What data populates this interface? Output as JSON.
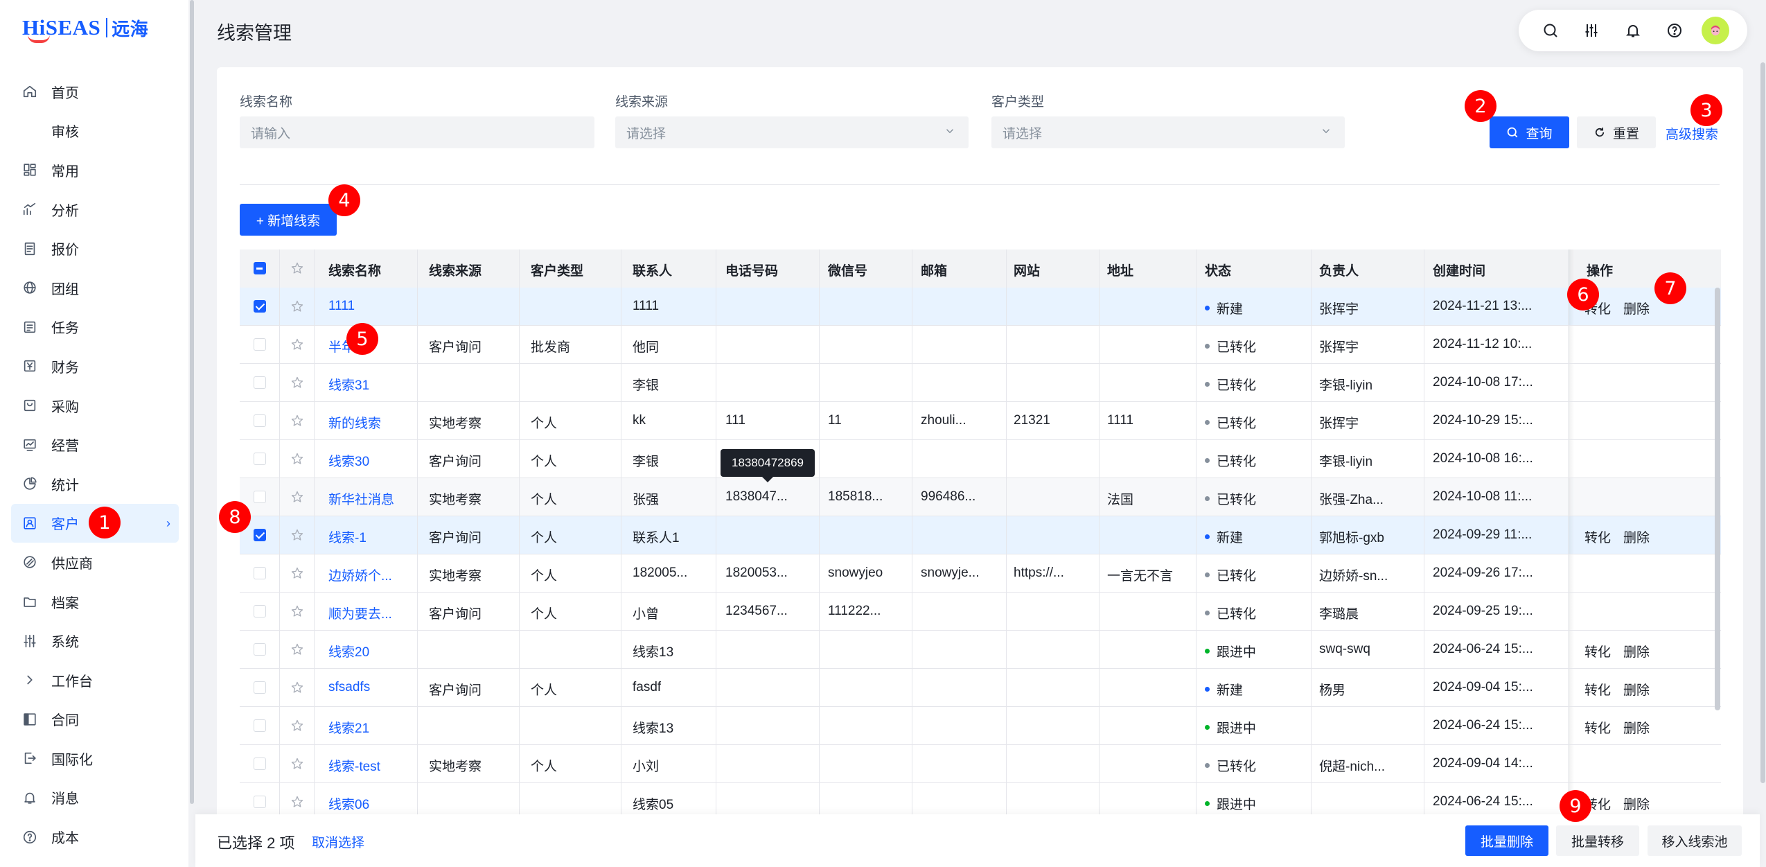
{
  "logo": {
    "brand": "HiSEAS",
    "brand_cn": "远海"
  },
  "page_title": "线索管理",
  "sidebar": {
    "items": [
      {
        "label": "首页",
        "icon": "home-icon"
      },
      {
        "label": "审核",
        "icon": ""
      },
      {
        "label": "常用",
        "icon": "grid-icon"
      },
      {
        "label": "分析",
        "icon": "trend-icon"
      },
      {
        "label": "报价",
        "icon": "doc-icon"
      },
      {
        "label": "团组",
        "icon": "globe-icon"
      },
      {
        "label": "任务",
        "icon": "task-icon"
      },
      {
        "label": "财务",
        "icon": "yen-icon"
      },
      {
        "label": "采购",
        "icon": "bag-icon"
      },
      {
        "label": "经营",
        "icon": "chart-icon"
      },
      {
        "label": "统计",
        "icon": "pie-icon"
      },
      {
        "label": "客户",
        "icon": "customer-icon",
        "active": true
      },
      {
        "label": "供应商",
        "icon": "link-icon"
      },
      {
        "label": "档案",
        "icon": "folder-icon"
      },
      {
        "label": "系统",
        "icon": "sliders-icon"
      },
      {
        "label": "工作台",
        "icon": "chevron-right-icon"
      },
      {
        "label": "合同",
        "icon": "contract-icon"
      },
      {
        "label": "国际化",
        "icon": "logout-icon"
      },
      {
        "label": "消息",
        "icon": "bell-icon"
      },
      {
        "label": "成本",
        "icon": "help-icon"
      }
    ]
  },
  "filters": {
    "name_label": "线索名称",
    "name_placeholder": "请输入",
    "source_label": "线索来源",
    "source_placeholder": "请选择",
    "customer_type_label": "客户类型",
    "customer_type_placeholder": "请选择",
    "query_button": "查询",
    "reset_button": "重置",
    "advanced_search": "高级搜索"
  },
  "add_button": "+ 新增线索",
  "table": {
    "columns": [
      "线索名称",
      "线索来源",
      "客户类型",
      "联系人",
      "电话号码",
      "微信号",
      "邮箱",
      "网站",
      "地址",
      "状态",
      "负责人",
      "创建时间",
      "操作"
    ],
    "rows": [
      {
        "name": "1111",
        "source": "",
        "ctype": "",
        "contact": "1111",
        "phone": "",
        "wechat": "",
        "email": "",
        "site": "",
        "addr": "",
        "status": "新建",
        "owner": "张挥宇",
        "created": "2024-11-21 13:...",
        "convert": "转化",
        "delete": "删除",
        "checked": true
      },
      {
        "name": "半年",
        "source": "客户询问",
        "ctype": "批发商",
        "contact": "他同",
        "phone": "",
        "wechat": "",
        "email": "",
        "site": "",
        "addr": "",
        "status": "已转化",
        "owner": "张挥宇",
        "created": "2024-11-12 10:...",
        "convert": "",
        "delete": "",
        "checked": false
      },
      {
        "name": "线索31",
        "source": "",
        "ctype": "",
        "contact": "李银",
        "phone": "",
        "wechat": "",
        "email": "",
        "site": "",
        "addr": "",
        "status": "已转化",
        "owner": "李银-liyin",
        "created": "2024-10-08 17:...",
        "convert": "",
        "delete": "",
        "checked": false
      },
      {
        "name": "新的线索",
        "source": "实地考察",
        "ctype": "个人",
        "contact": "kk",
        "phone": "111",
        "wechat": "11",
        "email": "zhouli...",
        "site": "21321",
        "addr": "1111",
        "status": "已转化",
        "owner": "张挥宇",
        "created": "2024-10-29 15:...",
        "convert": "",
        "delete": "",
        "checked": false
      },
      {
        "name": "线索30",
        "source": "客户询问",
        "ctype": "个人",
        "contact": "李银",
        "phone": "",
        "wechat": "",
        "email": "",
        "site": "",
        "addr": "",
        "status": "已转化",
        "owner": "李银-liyin",
        "created": "2024-10-08 16:...",
        "convert": "",
        "delete": "",
        "checked": false
      },
      {
        "name": "新华社消息",
        "source": "实地考察",
        "ctype": "个人",
        "contact": "张强",
        "phone": "1838047...",
        "wechat": "185818...",
        "email": "996486...",
        "site": "",
        "addr": "法国",
        "status": "已转化",
        "owner": "张强-Zha...",
        "created": "2024-10-08 11:...",
        "convert": "",
        "delete": "",
        "checked": false
      },
      {
        "name": "线索-1",
        "source": "客户询问",
        "ctype": "个人",
        "contact": "联系人1",
        "phone": "",
        "wechat": "",
        "email": "",
        "site": "",
        "addr": "",
        "status": "新建",
        "owner": "郭旭标-gxb",
        "created": "2024-09-29 11:...",
        "convert": "转化",
        "delete": "删除",
        "checked": true
      },
      {
        "name": "边娇娇个...",
        "source": "实地考察",
        "ctype": "个人",
        "contact": "182005...",
        "phone": "1820053...",
        "wechat": "snowyjeo",
        "email": "snowyje...",
        "site": "https://...",
        "addr": "一言无不言",
        "status": "已转化",
        "owner": "边娇娇-sn...",
        "created": "2024-09-26 17:...",
        "convert": "",
        "delete": "",
        "checked": false
      },
      {
        "name": "顺为要去...",
        "source": "客户询问",
        "ctype": "个人",
        "contact": "小曾",
        "phone": "1234567...",
        "wechat": "111222...",
        "email": "",
        "site": "",
        "addr": "",
        "status": "已转化",
        "owner": "李璐晨",
        "created": "2024-09-25 19:...",
        "convert": "",
        "delete": "",
        "checked": false
      },
      {
        "name": "线索20",
        "source": "",
        "ctype": "",
        "contact": "线索13",
        "phone": "",
        "wechat": "",
        "email": "",
        "site": "",
        "addr": "",
        "status": "跟进中",
        "owner": "swq-swq",
        "created": "2024-06-24 15:...",
        "convert": "转化",
        "delete": "删除",
        "checked": false
      },
      {
        "name": "sfsadfs",
        "source": "客户询问",
        "ctype": "个人",
        "contact": "fasdf",
        "phone": "",
        "wechat": "",
        "email": "",
        "site": "",
        "addr": "",
        "status": "新建",
        "owner": "杨男",
        "created": "2024-09-04 15:...",
        "convert": "转化",
        "delete": "删除",
        "checked": false
      },
      {
        "name": "线索21",
        "source": "",
        "ctype": "",
        "contact": "线索13",
        "phone": "",
        "wechat": "",
        "email": "",
        "site": "",
        "addr": "",
        "status": "跟进中",
        "owner": "",
        "created": "2024-06-24 15:...",
        "convert": "转化",
        "delete": "删除",
        "checked": false
      },
      {
        "name": "线索-test",
        "source": "实地考察",
        "ctype": "个人",
        "contact": "小刘",
        "phone": "",
        "wechat": "",
        "email": "",
        "site": "",
        "addr": "",
        "status": "已转化",
        "owner": "倪超-nich...",
        "created": "2024-09-04 14:...",
        "convert": "",
        "delete": "",
        "checked": false
      },
      {
        "name": "线索06",
        "source": "",
        "ctype": "",
        "contact": "线索05",
        "phone": "",
        "wechat": "",
        "email": "",
        "site": "",
        "addr": "",
        "status": "跟进中",
        "owner": "",
        "created": "2024-06-24 15:...",
        "convert": "转化",
        "delete": "删除",
        "checked": false
      }
    ]
  },
  "tooltip": "18380472869",
  "footer": {
    "selected_text": "已选择 2 项",
    "cancel_selection": "取消选择",
    "batch_delete": "批量删除",
    "batch_transfer": "批量转移",
    "move_to_pool": "移入线索池"
  },
  "markers": [
    "1",
    "2",
    "3",
    "4",
    "5",
    "6",
    "7",
    "8",
    "9"
  ],
  "colors": {
    "primary": "#165dff",
    "danger": "#f53f3f",
    "success": "#00b42a",
    "marker": "#ff0000"
  }
}
